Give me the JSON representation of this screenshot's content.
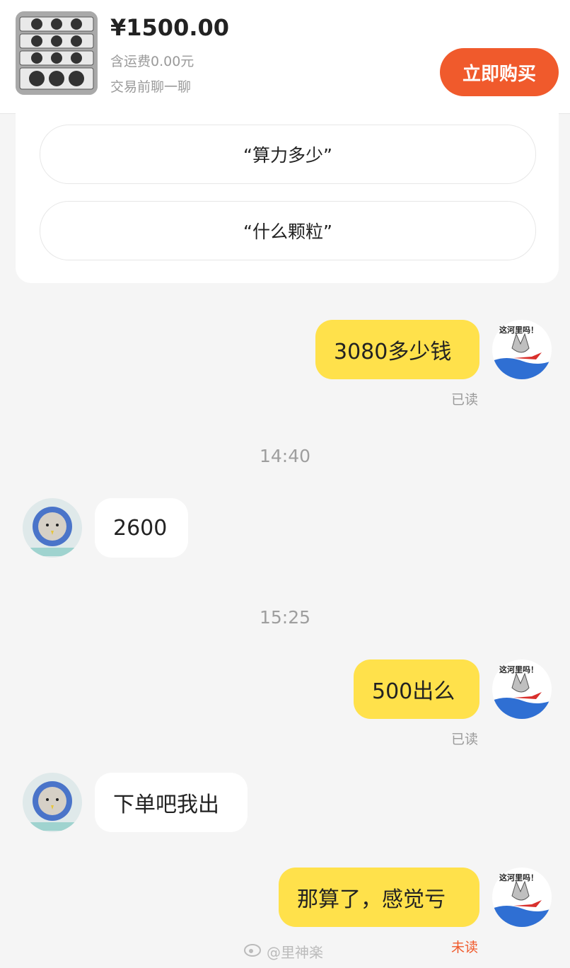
{
  "header": {
    "price": "¥1500.00",
    "shipping": "含运费0.00元",
    "chat_tip": "交易前聊一聊",
    "buy_label": "立即购买"
  },
  "quick_replies": [
    "“算力多少”",
    "“什么颗粒”"
  ],
  "messages": [
    {
      "from": "me",
      "text": "3080多少钱",
      "status": "已读"
    },
    {
      "time": "14:40"
    },
    {
      "from": "other",
      "text": "2600"
    },
    {
      "time": "15:25"
    },
    {
      "from": "me",
      "text": "500出么",
      "status": "已读"
    },
    {
      "from": "other",
      "text": "下单吧我出"
    },
    {
      "from": "me",
      "text": "那算了，感觉亏",
      "status": "未读"
    }
  ],
  "avatar_me_caption": "这河里吗！",
  "watermark": "@里神楽",
  "colors": {
    "accent": "#f05a2c",
    "my_bubble": "#ffe14b",
    "background": "#f5f5f5"
  }
}
